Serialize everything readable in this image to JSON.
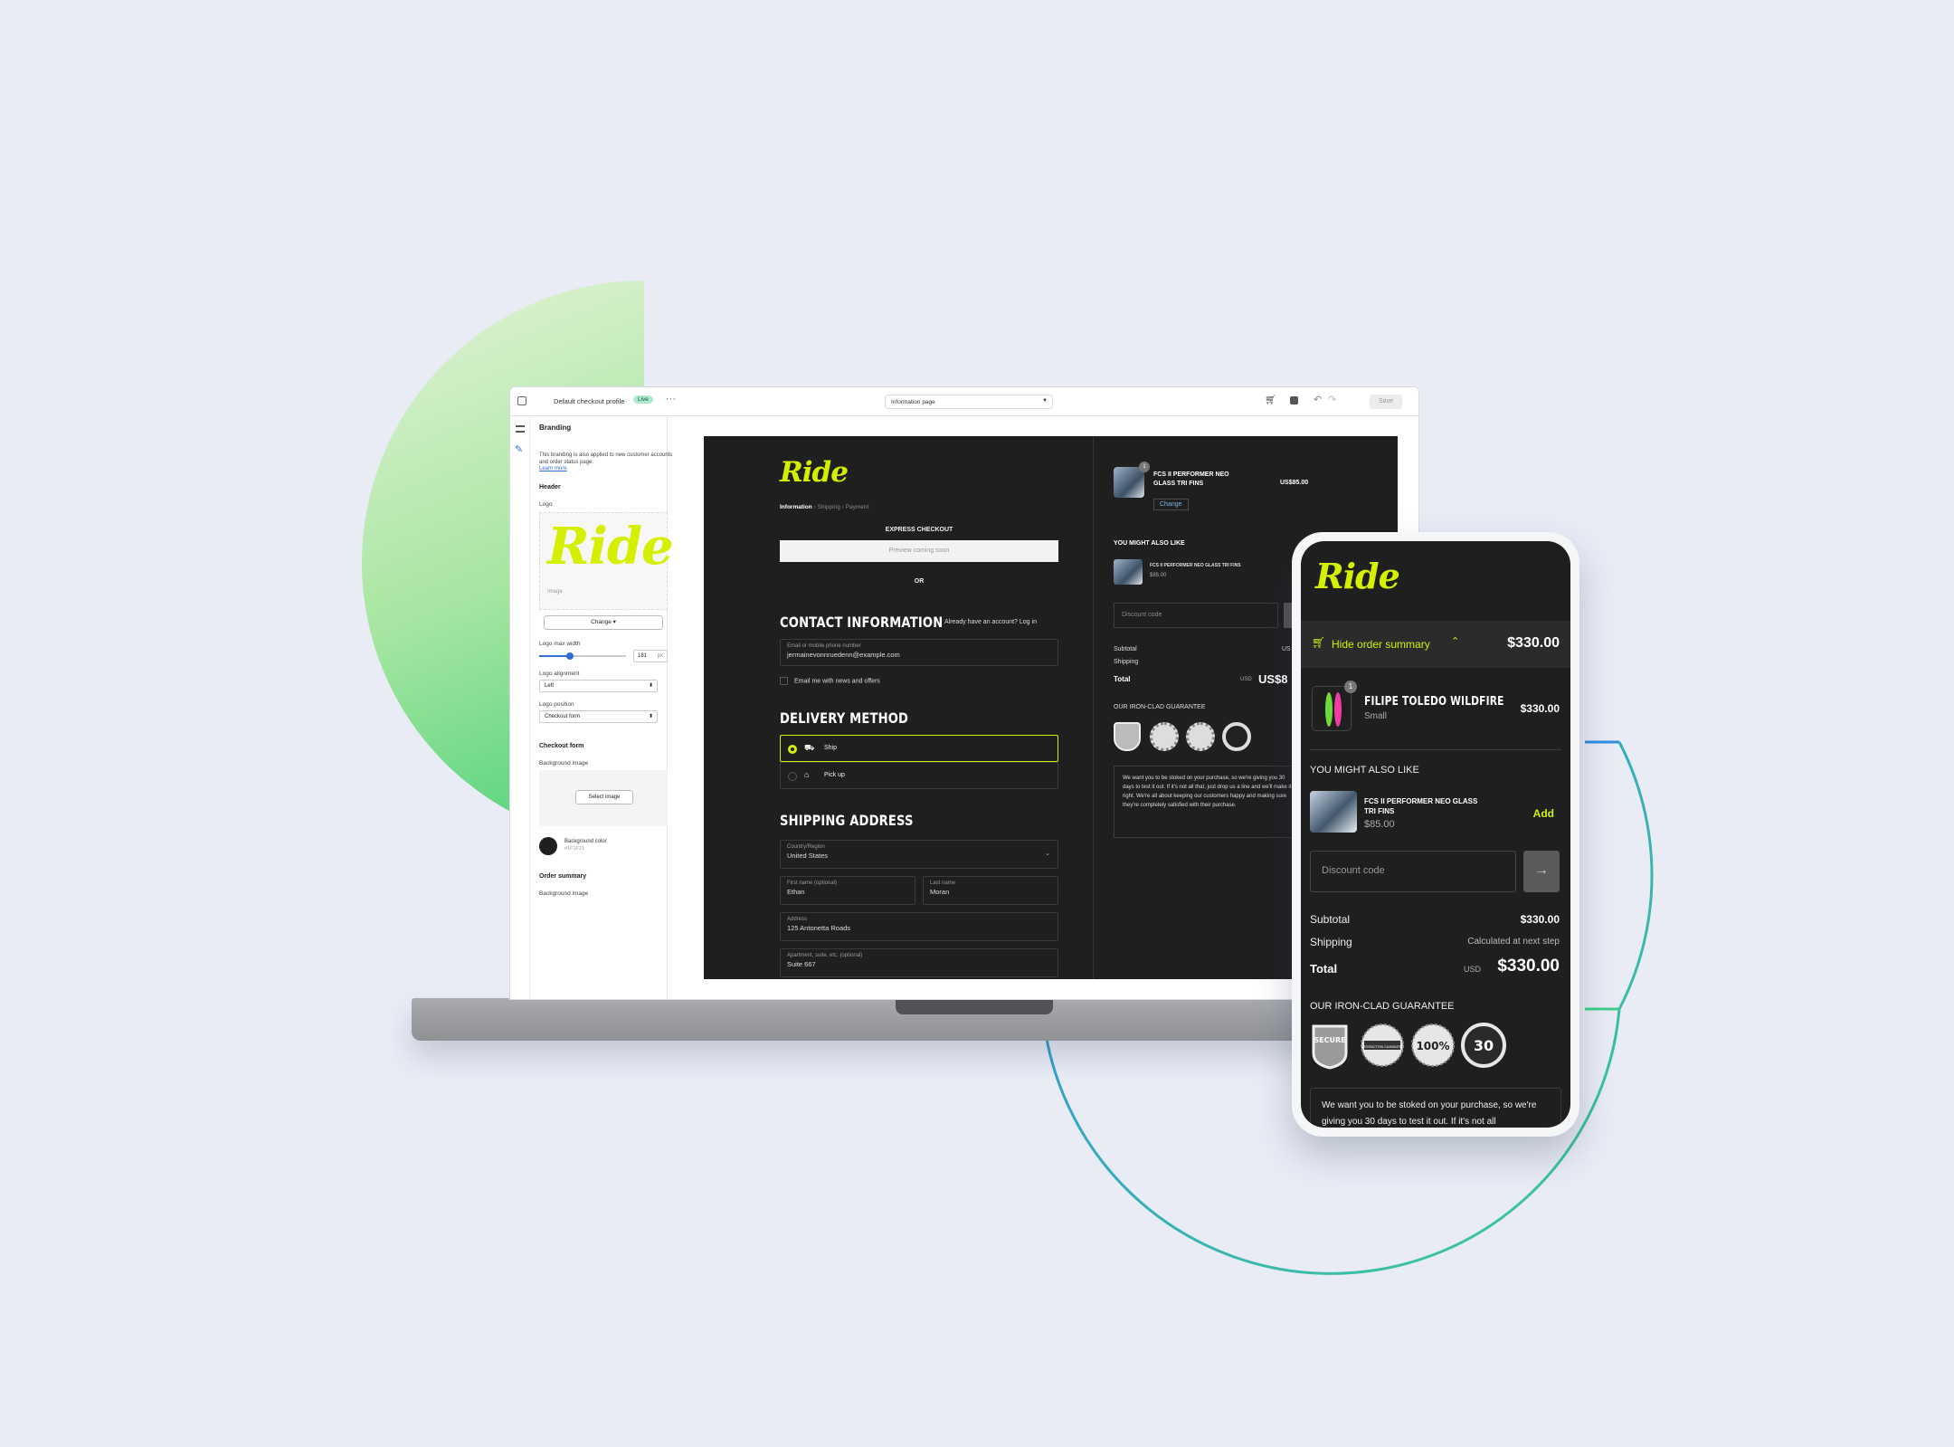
{
  "editor": {
    "profile_name": "Default checkout profile",
    "live_badge": "Live",
    "page_select": "Information page",
    "save_label": "Save",
    "settings": {
      "section_title": "Branding",
      "note": "This branding is also applied to new customer accounts and order status page.",
      "learn_more": "Learn more",
      "header_label": "Header",
      "logo_label": "Logo",
      "logo_text": "Ride",
      "logo_caption": "Image",
      "change_button": "Change",
      "logo_max_width_label": "Logo max width",
      "logo_max_width_value": "181",
      "logo_max_width_unit": "px",
      "logo_alignment_label": "Logo alignment",
      "logo_alignment_value": "Left",
      "logo_position_label": "Logo position",
      "logo_position_value": "Checkout form",
      "checkout_form_label": "Checkout form",
      "background_image_label": "Background image",
      "select_image_button": "Select image",
      "background_color_label": "Background color",
      "background_color_value": "#1F1F21",
      "order_summary_label": "Order summary",
      "order_summary_bg_label": "Background image"
    }
  },
  "checkout": {
    "brand": "Ride",
    "breadcrumb": [
      "Information",
      "Shipping",
      "Payment"
    ],
    "express_title": "EXPRESS CHECKOUT",
    "express_button": "Preview coming soon",
    "or_label": "OR",
    "contact_title": "CONTACT INFORMATION",
    "account_prompt": "Already have an account? Log in",
    "email_label": "Email or mobile phone number",
    "email_value": "jermainevonnruedenn@example.com",
    "news_opt_in": "Email me with news and offers",
    "delivery_title": "DELIVERY METHOD",
    "delivery_options": [
      "Ship",
      "Pick up"
    ],
    "shipping_title": "SHIPPING ADDRESS",
    "country_label": "Country/Region",
    "country_value": "United States",
    "first_name_label": "First name (optional)",
    "first_name_value": "Ethan",
    "last_name_label": "Last name",
    "last_name_value": "Moran",
    "address_label": "Address",
    "address_value": "125 Antonetta Roads",
    "apartment_label": "Apartment, suite, etc. (optional)",
    "apartment_value": "Suite 667"
  },
  "summary_desktop": {
    "item_name": "FCS II PERFORMER NEO GLASS TRI FINS",
    "item_price": "US$85.00",
    "item_qty": "1",
    "change_label": "Change",
    "upsell_title": "YOU MIGHT ALSO LIKE",
    "upsell_name": "FCS II PERFORMER NEO GLASS TRI FINS",
    "upsell_price": "$85.00",
    "discount_placeholder": "Discount code",
    "subtotal_label": "Subtotal",
    "subtotal_value": "US",
    "shipping_label": "Shipping",
    "total_label": "Total",
    "total_currency": "USD",
    "total_value": "US$8",
    "guarantee_title": "OUR IRON-CLAD GUARANTEE",
    "guarantee_text": "We want you to be stoked on your purchase, so we're giving you 30 days to test it out. If it's not all that, just drop us a line and we'll make it right. We're all about keeping our customers happy and making sure they're completely satisfied with their purchase."
  },
  "mobile": {
    "brand": "Ride",
    "summary_toggle": "Hide order summary",
    "summary_total": "$330.00",
    "item_name": "FILIPE TOLEDO WILDFIRE",
    "item_variant": "Small",
    "item_price": "$330.00",
    "item_qty": "1",
    "upsell_title": "YOU MIGHT ALSO LIKE",
    "upsell_name": "FCS II PERFORMER NEO GLASS TRI FINS",
    "upsell_price": "$85.00",
    "add_label": "Add",
    "discount_placeholder": "Discount code",
    "subtotal_label": "Subtotal",
    "subtotal_value": "$330.00",
    "shipping_label": "Shipping",
    "shipping_value": "Calculated at next step",
    "total_label": "Total",
    "total_currency": "USD",
    "total_value": "$330.00",
    "guarantee_title": "OUR IRON-CLAD GUARANTEE",
    "badges": [
      "SECURE",
      "SATISFACTION GUARANTEE",
      "100%",
      "30"
    ],
    "guarantee_text": "We want you to be stoked on your purchase, so we're giving you 30 days to test it out. If it's not all"
  },
  "colors": {
    "accent": "#d4f000",
    "dark": "#1f1f1f",
    "background": "#e9ecf5",
    "ring_green": "#3ecf8e",
    "ring_blue": "#2f8de4"
  }
}
